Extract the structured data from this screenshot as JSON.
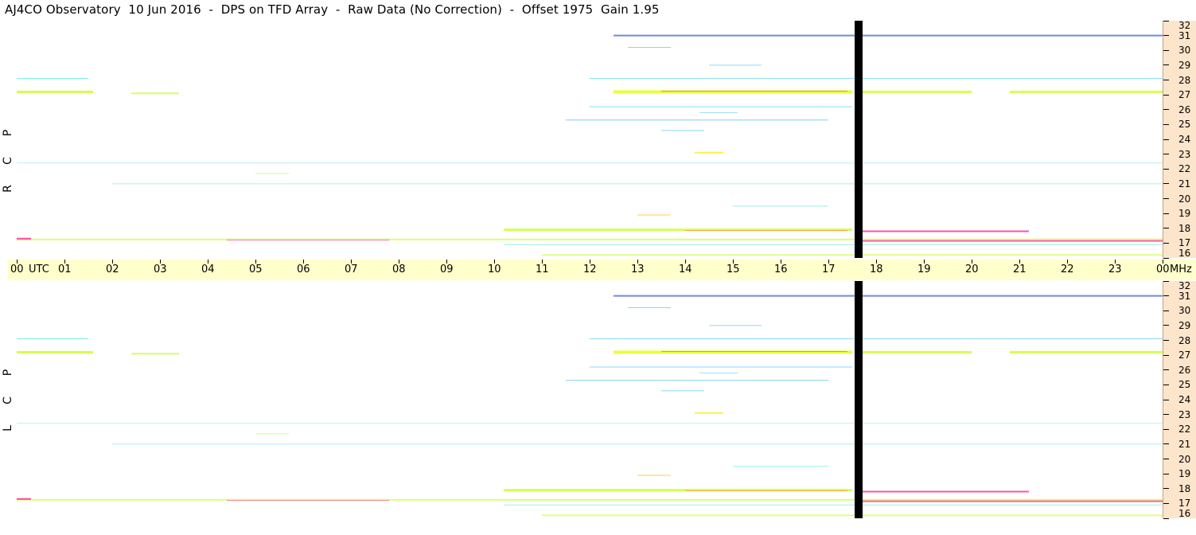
{
  "title": "AJ4CO Observatory  10 Jun 2016  -  DPS on TFD Array  -  Raw Data (No Correction)  -  Offset 1975  Gain 1.95",
  "panels": [
    {
      "polarization": [
        "R",
        "C",
        "P"
      ]
    },
    {
      "polarization": [
        "L",
        "C",
        "P"
      ]
    }
  ],
  "time_axis": {
    "labels": [
      "00",
      "01",
      "02",
      "03",
      "04",
      "05",
      "06",
      "07",
      "08",
      "09",
      "10",
      "11",
      "12",
      "13",
      "14",
      "15",
      "16",
      "17",
      "18",
      "19",
      "20",
      "21",
      "22",
      "23",
      "00"
    ],
    "unit_left": "UTC",
    "unit_right": "MHz"
  },
  "freq_axis": {
    "labels": [
      "32",
      "31",
      "30",
      "29",
      "28",
      "27",
      "26",
      "25",
      "24",
      "23",
      "22",
      "21",
      "20",
      "19",
      "18",
      "17",
      "16"
    ]
  },
  "chart_data": {
    "type": "heatmap",
    "title": "AJ4CO Observatory  10 Jun 2016  -  DPS on TFD Array  -  Raw Data (No Correction)  -  Offset 1975  Gain 1.95",
    "x": [
      "00",
      "01",
      "02",
      "03",
      "04",
      "05",
      "06",
      "07",
      "08",
      "09",
      "10",
      "11",
      "12",
      "13",
      "14",
      "15",
      "16",
      "17",
      "18",
      "19",
      "20",
      "21",
      "22",
      "23",
      "00"
    ],
    "x_unit": "UTC",
    "y_unit": "MHz",
    "ylim": [
      16,
      32
    ],
    "panels": [
      "RCP",
      "LCP"
    ],
    "data_gap_hours": [
      17.5,
      17.65
    ],
    "colormap": [
      "#001a66",
      "#0b33b8",
      "#1a66ff",
      "#19b8f0",
      "#33e6cc",
      "#ccff33",
      "#ff3399"
    ]
  }
}
